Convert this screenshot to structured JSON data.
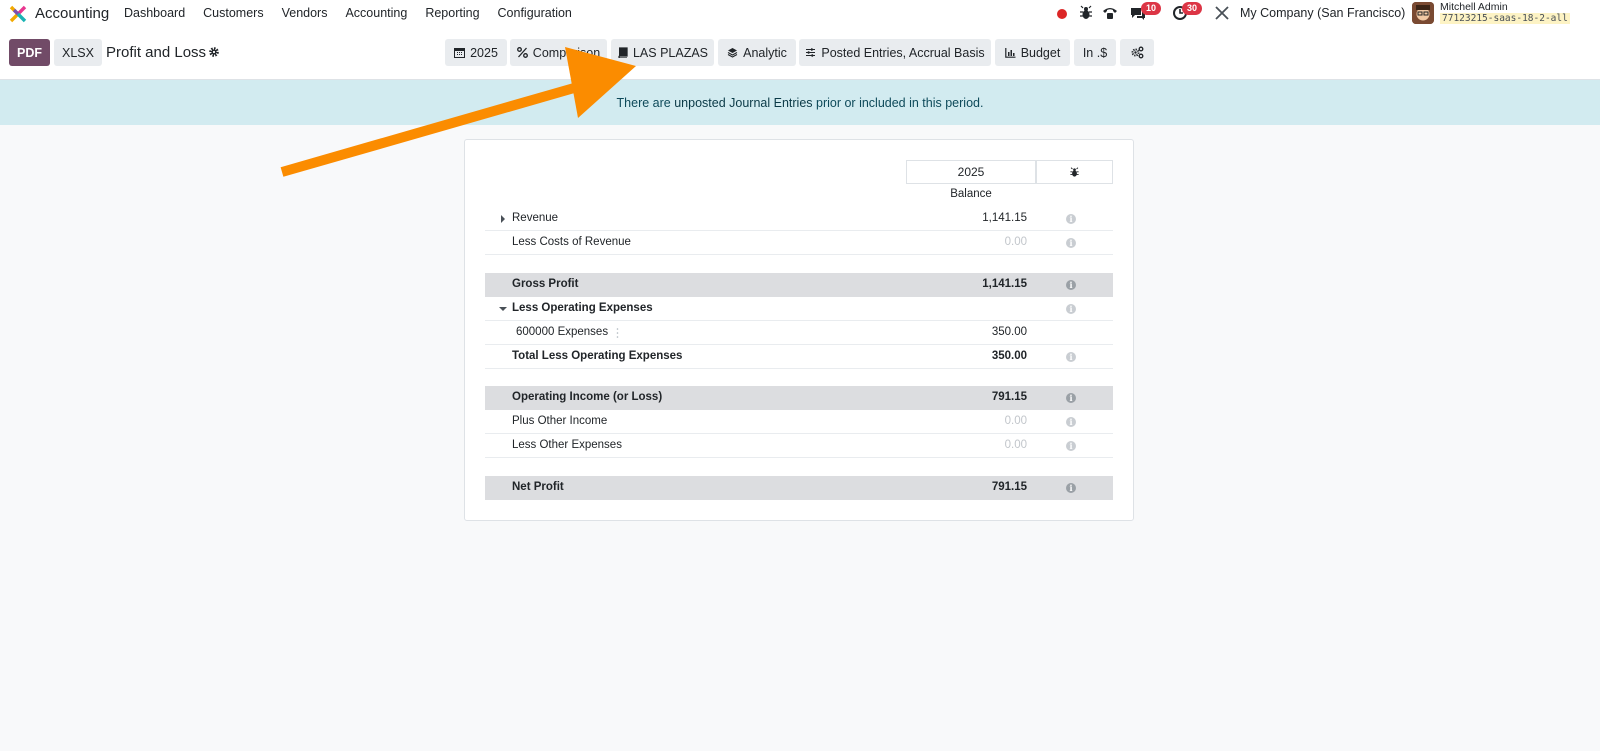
{
  "app": {
    "name": "Accounting"
  },
  "menu": [
    "Dashboard",
    "Customers",
    "Vendors",
    "Accounting",
    "Reporting",
    "Configuration"
  ],
  "systray": {
    "messages_count": "10",
    "activities_count": "30",
    "company": "My Company (San Francisco)",
    "user_name": "Mitchell Admin",
    "database": "77123215-saas-18-2-all"
  },
  "control": {
    "pdf_label": "PDF",
    "xlsx_label": "XLSX",
    "report_title": "Profit and Loss",
    "filters": {
      "date": "2025",
      "comparison": "Comparison",
      "journal": "LAS PLAZAS",
      "analytic": "Analytic",
      "entries": "Posted Entries, Accrual Basis",
      "budget": "Budget",
      "currency": "In .$"
    }
  },
  "alert": {
    "prefix": "There are ",
    "link": "unposted Journal Entries",
    "suffix": " prior or included in this period."
  },
  "report": {
    "column_year": "2025",
    "column_label": "Balance",
    "rows": [
      {
        "label": "Revenue",
        "value": "1,141.15"
      },
      {
        "label": "Less Costs of Revenue",
        "value": "0.00"
      },
      {
        "label": "Gross Profit",
        "value": "1,141.15"
      },
      {
        "label": "Less Operating Expenses",
        "value": ""
      },
      {
        "label": "600000 Expenses",
        "value": "350.00"
      },
      {
        "label": "Total Less Operating Expenses",
        "value": "350.00"
      },
      {
        "label": "Operating Income (or Loss)",
        "value": "791.15"
      },
      {
        "label": "Plus Other Income",
        "value": "0.00"
      },
      {
        "label": "Less Other Expenses",
        "value": "0.00"
      },
      {
        "label": "Net Profit",
        "value": "791.15"
      }
    ]
  },
  "colors": {
    "brand": "#714b67",
    "alert_bg": "#d2ebf0",
    "annotation_arrow": "#fb8c00",
    "badge": "#dc3545"
  }
}
